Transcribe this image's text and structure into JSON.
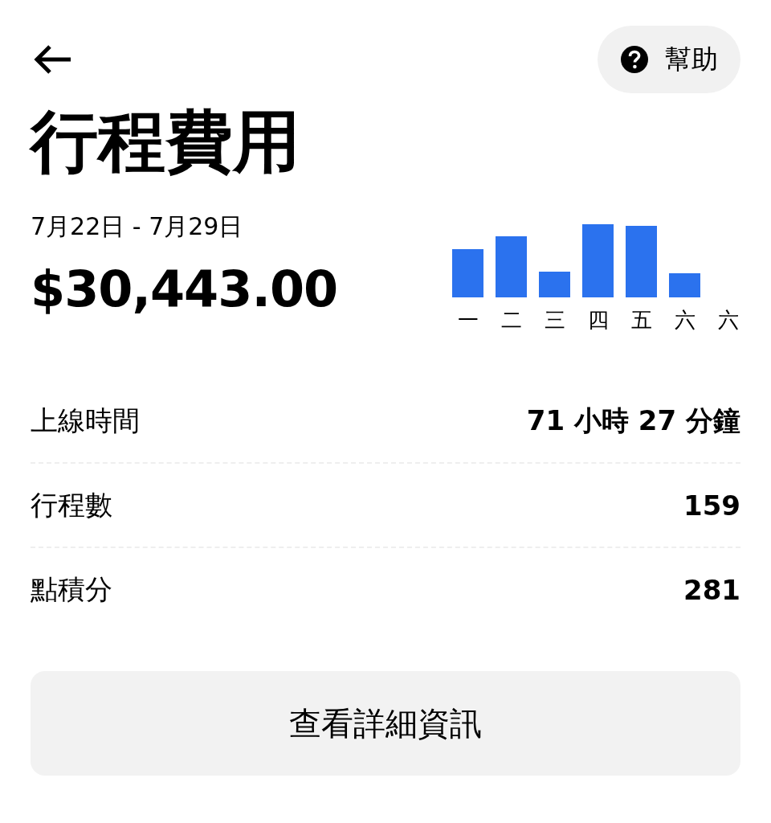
{
  "help_button": {
    "label": "幫助"
  },
  "title": "行程費用",
  "date_range": "7月22日 - 7月29日",
  "total": "$30,443.00",
  "weekday_labels": [
    "一",
    "二",
    "三",
    "四",
    "五",
    "六",
    "六"
  ],
  "stats": [
    {
      "label": "上線時間",
      "value": "71 小時 27 分鐘"
    },
    {
      "label": "行程數",
      "value": "159"
    },
    {
      "label": "點積分",
      "value": "281"
    }
  ],
  "details_button": {
    "label": "查看詳細資訊"
  }
}
